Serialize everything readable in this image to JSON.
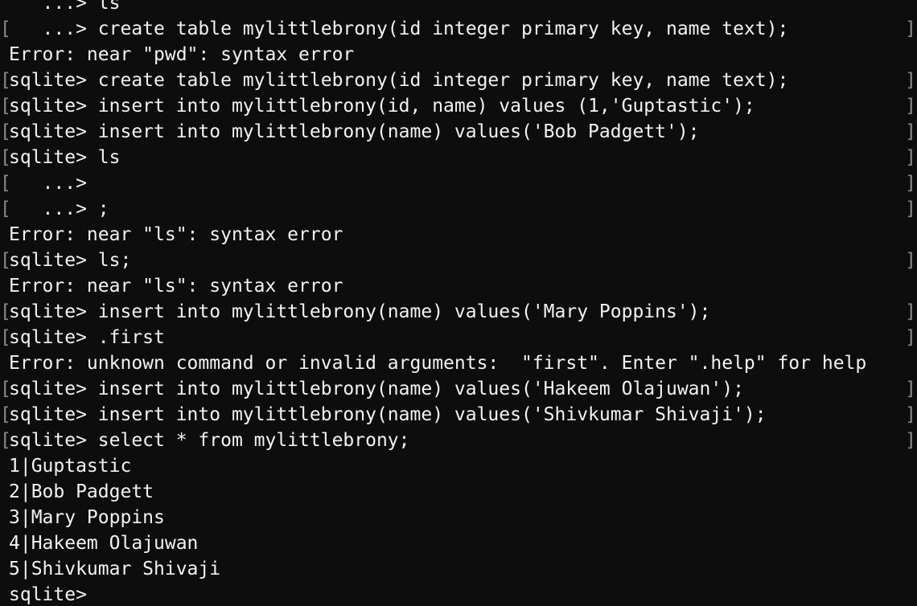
{
  "terminal": {
    "background": "#0d0d0d",
    "foreground": "#f2f2f2",
    "bracket_char_left": "[",
    "bracket_char_right": "]",
    "lines": [
      {
        "text": "   ...> ls",
        "bracket": false
      },
      {
        "text": "   ...> create table mylittlebrony(id integer primary key, name text);",
        "bracket": true
      },
      {
        "text": "Error: near \"pwd\": syntax error",
        "bracket": false
      },
      {
        "text": "sqlite> create table mylittlebrony(id integer primary key, name text);",
        "bracket": true
      },
      {
        "text": "sqlite> insert into mylittlebrony(id, name) values (1,'Guptastic');",
        "bracket": true
      },
      {
        "text": "sqlite> insert into mylittlebrony(name) values('Bob Padgett');",
        "bracket": true
      },
      {
        "text": "sqlite> ls",
        "bracket": true
      },
      {
        "text": "   ...>",
        "bracket": true
      },
      {
        "text": "   ...> ;",
        "bracket": true
      },
      {
        "text": "Error: near \"ls\": syntax error",
        "bracket": false
      },
      {
        "text": "sqlite> ls;",
        "bracket": true
      },
      {
        "text": "Error: near \"ls\": syntax error",
        "bracket": false
      },
      {
        "text": "sqlite> insert into mylittlebrony(name) values('Mary Poppins');",
        "bracket": true
      },
      {
        "text": "sqlite> .first",
        "bracket": true
      },
      {
        "text": "Error: unknown command or invalid arguments:  \"first\". Enter \".help\" for help",
        "bracket": false
      },
      {
        "text": "sqlite> insert into mylittlebrony(name) values('Hakeem Olajuwan');",
        "bracket": true
      },
      {
        "text": "sqlite> insert into mylittlebrony(name) values('Shivkumar Shivaji');",
        "bracket": true
      },
      {
        "text": "sqlite> select * from mylittlebrony;",
        "bracket": true
      },
      {
        "text": "1|Guptastic",
        "bracket": false
      },
      {
        "text": "2|Bob Padgett",
        "bracket": false
      },
      {
        "text": "3|Mary Poppins",
        "bracket": false
      },
      {
        "text": "4|Hakeem Olajuwan",
        "bracket": false
      },
      {
        "text": "5|Shivkumar Shivaji",
        "bracket": false
      },
      {
        "text": "sqlite> ",
        "bracket": false,
        "cursor": true
      }
    ]
  }
}
